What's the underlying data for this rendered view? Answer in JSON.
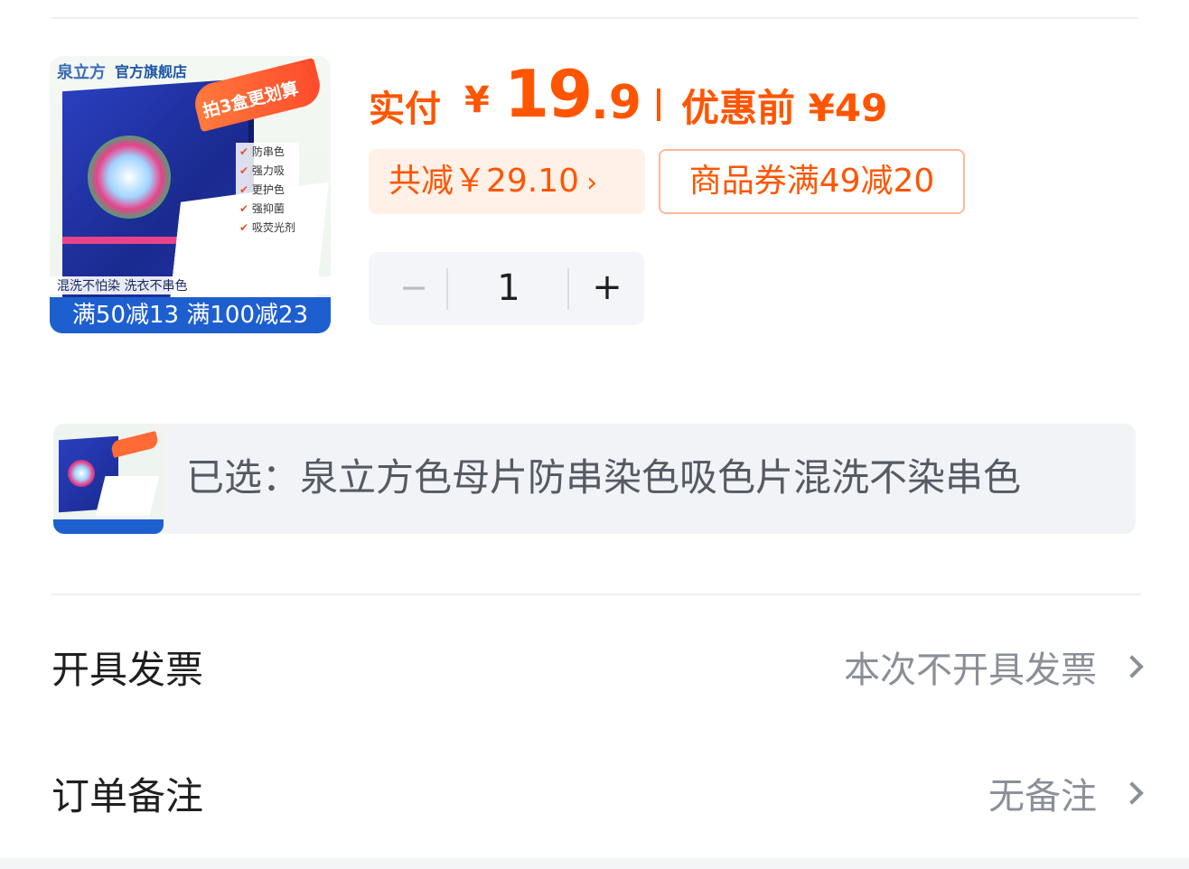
{
  "product": {
    "image_alt": "泉立方色母片产品图",
    "brand_logo_text": "泉立方",
    "store_tag": "官方旗舰店",
    "flame_text": "拍3盒更划算",
    "features": [
      "防串色",
      "强力吸",
      "更护色",
      "强抑菌",
      "吸荧光剂"
    ],
    "slogan": "混洗不怕染 洗衣不串色",
    "promo_banner": "满50减13 满100减23"
  },
  "price": {
    "pay_label": "实付",
    "currency": "¥",
    "integer_part": "19",
    "decimal_part": ".9",
    "original_price": "优惠前 ¥49"
  },
  "discount": {
    "total_reduction": "共减￥29.10",
    "coupon": "商品券满49减20"
  },
  "quantity": {
    "minus": "−",
    "value": "1",
    "plus": "+"
  },
  "selected": {
    "text": "已选：泉立方色母片防串染色吸色片混洗不染串色"
  },
  "settings": {
    "invoice": {
      "label": "开具发票",
      "value": "本次不开具发票"
    },
    "remark": {
      "label": "订单备注",
      "value": "无备注"
    }
  },
  "colors": {
    "accent": "#ff5500",
    "chip_bg": "#fff1e8",
    "coupon_border": "#ffb89a",
    "muted_text": "#8a8f98",
    "panel_bg": "#f1f3f7"
  },
  "icons": {
    "discount_chevron": "chevron-right-icon",
    "row_chevron": "chevron-right-icon"
  }
}
